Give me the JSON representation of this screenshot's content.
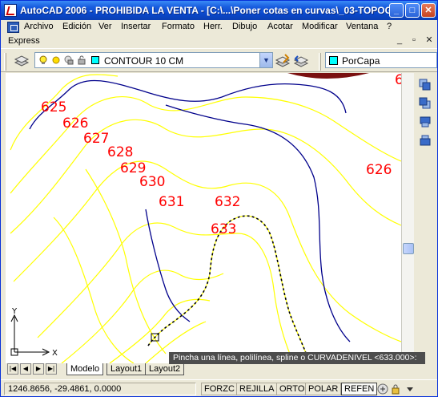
{
  "window": {
    "title": "AutoCAD 2006 - PROHIBIDA LA VENTA - [C:\\...\\Poner cotas en curvas\\_03-TOPOG...",
    "min_label": "_",
    "max_label": "□",
    "close_label": "✕"
  },
  "menu": {
    "items": [
      "Archivo",
      "Edición",
      "Ver",
      "Insertar",
      "Formato",
      "Herr.",
      "Dibujo",
      "Acotar",
      "Modificar",
      "Ventana",
      "?"
    ],
    "express": "Express"
  },
  "mdi": {
    "min": "_",
    "restore": "▫",
    "close": "✕"
  },
  "layer_toolbar": {
    "current_layer": "CONTOUR 10 CM",
    "color_value": "PorCapa",
    "layer_color": "#00ffff"
  },
  "drawing": {
    "contour_labels": [
      "625",
      "626",
      "627",
      "628",
      "629",
      "630",
      "631",
      "632",
      "633",
      "626",
      "6"
    ],
    "ucs_x": "X",
    "ucs_y": "Y",
    "contour_color_yellow": "#ffff00",
    "contour_color_blue": "#00008b",
    "label_color": "#ff0000"
  },
  "tabs": {
    "items": [
      "Modelo",
      "Layout1",
      "Layout2"
    ],
    "active": "Modelo"
  },
  "tooltip": "Pincha una línea, polilínea, spline o CURVADENIVEL <633.000>:",
  "status": {
    "coordinates": "1246.8656, -29.4861, 0.0000",
    "toggles": [
      "FORZC",
      "REJILLA",
      "ORTO",
      "POLAR",
      "REFEN"
    ],
    "active_toggles": [
      "REFEN"
    ]
  }
}
